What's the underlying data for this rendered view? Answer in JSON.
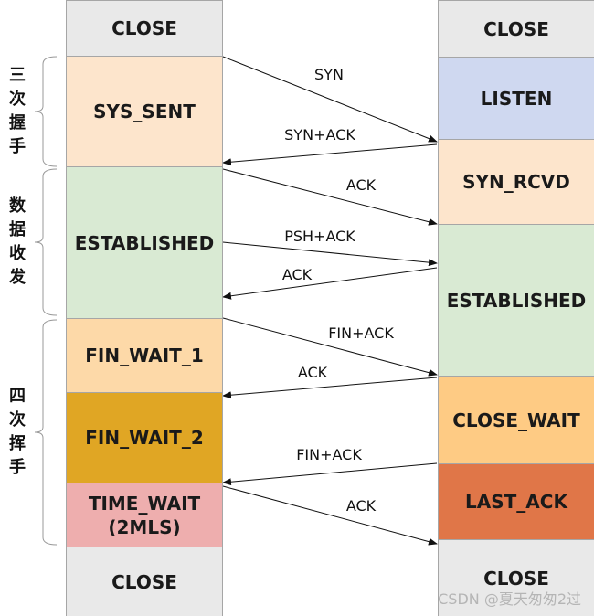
{
  "left_states": [
    {
      "label": "CLOSE",
      "color": "#e9e9e9"
    },
    {
      "label": "SYS_SENT",
      "color": "#fde5cc"
    },
    {
      "label": "ESTABLISHED",
      "color": "#d9ead3"
    },
    {
      "label": "FIN_WAIT_1",
      "color": "#fdd9a8"
    },
    {
      "label": "FIN_WAIT_2",
      "color": "#e0a624"
    },
    {
      "label": "TIME_WAIT\n(2MLS)",
      "color": "#eeaeae"
    },
    {
      "label": "CLOSE",
      "color": "#e9e9e9"
    }
  ],
  "right_states": [
    {
      "label": "CLOSE",
      "color": "#e9e9e9"
    },
    {
      "label": "LISTEN",
      "color": "#cfd8f0"
    },
    {
      "label": "SYN_RCVD",
      "color": "#fde5cc"
    },
    {
      "label": "ESTABLISHED",
      "color": "#d9ead3"
    },
    {
      "label": "CLOSE_WAIT",
      "color": "#fecb84"
    },
    {
      "label": "LAST_ACK",
      "color": "#e07648"
    },
    {
      "label": "CLOSE",
      "color": "#e9e9e9"
    }
  ],
  "messages": [
    {
      "label": "SYN",
      "direction": "right"
    },
    {
      "label": "SYN+ACK",
      "direction": "left"
    },
    {
      "label": "ACK",
      "direction": "right"
    },
    {
      "label": "PSH+ACK",
      "direction": "right"
    },
    {
      "label": "ACK",
      "direction": "left"
    },
    {
      "label": "FIN+ACK",
      "direction": "right"
    },
    {
      "label": "ACK",
      "direction": "left"
    },
    {
      "label": "FIN+ACK",
      "direction": "left"
    },
    {
      "label": "ACK",
      "direction": "right"
    }
  ],
  "phases": [
    "三次握手",
    "数据收发",
    "四次挥手"
  ],
  "watermark": "CSDN @夏天匆匆2过"
}
